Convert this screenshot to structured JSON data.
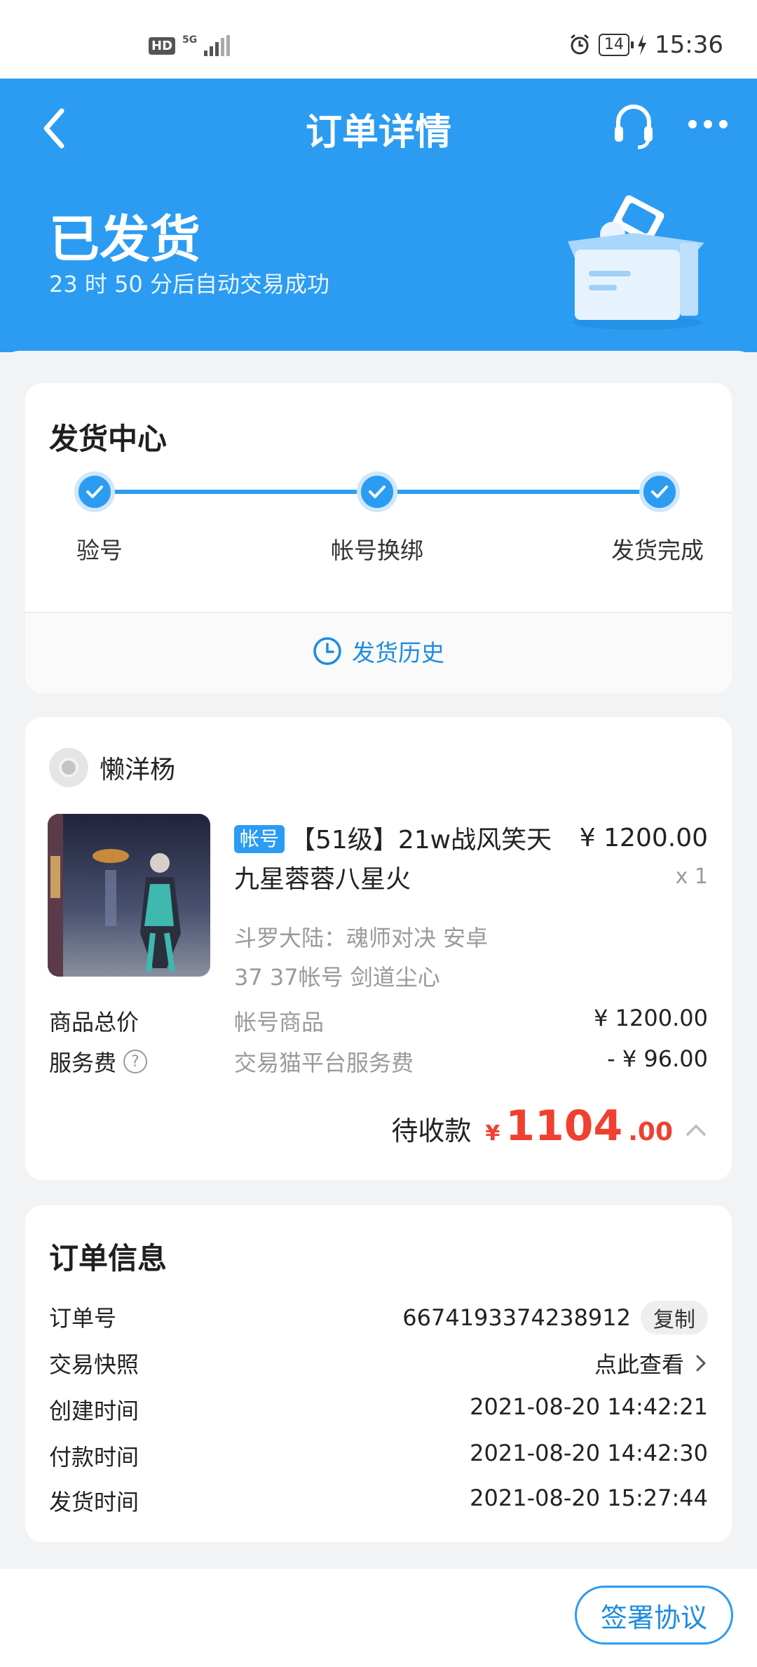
{
  "status_bar": {
    "left_badges": [
      "HD",
      "5G"
    ],
    "battery": "14",
    "time": "15:36"
  },
  "header": {
    "title": "订单详情",
    "status": "已发货",
    "status_sub": "23 时 50 分后自动交易成功",
    "colors": {
      "primary": "#2b9cf2"
    },
    "icons": [
      "back-arrow-icon",
      "headset-icon",
      "more-icon",
      "package-box-icon"
    ]
  },
  "delivery": {
    "title": "发货中心",
    "steps": [
      {
        "label": "验号",
        "done": true
      },
      {
        "label": "帐号换绑",
        "done": true
      },
      {
        "label": "发货完成",
        "done": true
      }
    ],
    "history_label": "发货历史"
  },
  "product": {
    "seller": "懒洋杨",
    "tag": "帐号",
    "title": "【51级】21w战风笑天九星蓉蓉八星火",
    "price": "¥ 1200.00",
    "qty": "x 1",
    "game": "斗罗大陆：魂师对决  安卓",
    "meta": "37  37帐号  剑道尘心",
    "fees": [
      {
        "label": "商品总价",
        "desc": "帐号商品",
        "value": "¥ 1200.00"
      },
      {
        "label": "服务费",
        "desc": "交易猫平台服务费",
        "value": "- ¥ 96.00"
      }
    ],
    "total_label": "待收款",
    "total_currency": "¥",
    "total_int": "1104",
    "total_dec": ".00",
    "total_color": "#f04030"
  },
  "order": {
    "title": "订单信息",
    "rows": [
      {
        "label": "订单号",
        "value": "6674193374238912",
        "action": "复制"
      },
      {
        "label": "交易快照",
        "value": "点此查看"
      },
      {
        "label": "创建时间",
        "value": "2021-08-20 14:42:21"
      },
      {
        "label": "付款时间",
        "value": "2021-08-20 14:42:30"
      },
      {
        "label": "发货时间",
        "value": "2021-08-20 15:27:44"
      }
    ]
  },
  "bottom": {
    "sign_label": "签署协议"
  }
}
